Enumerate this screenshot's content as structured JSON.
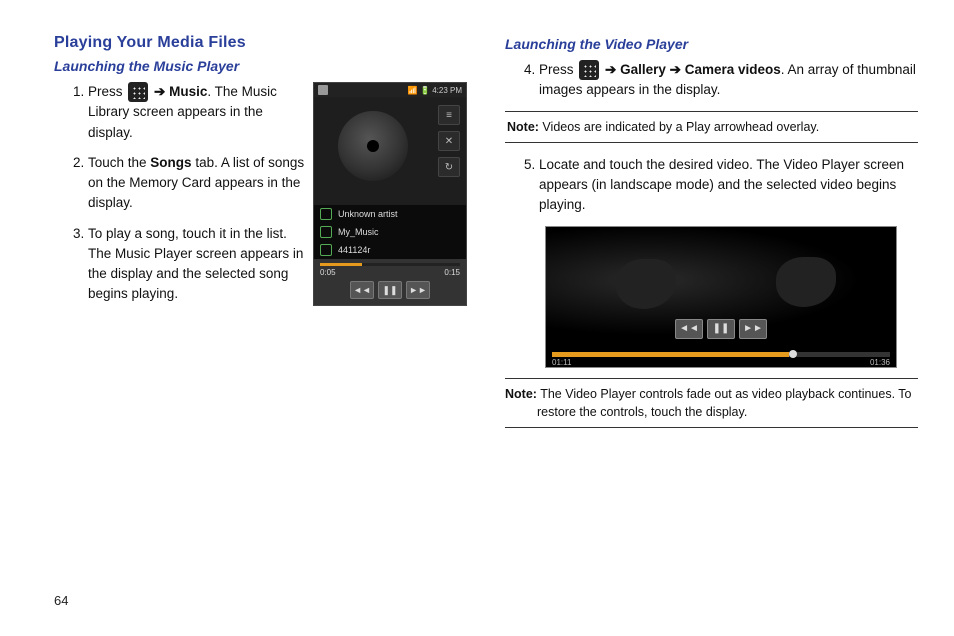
{
  "page_number": "64",
  "left": {
    "section_title": "Playing Your Media Files",
    "subhead": "Launching the Music Player",
    "steps": {
      "s1_a": "Press ",
      "s1_b": " ➔ ",
      "s1_c": "Music",
      "s1_d": ". The Music Library screen appears in the display.",
      "s2_a": "Touch the ",
      "s2_b": "Songs",
      "s2_c": " tab. A list of songs on the Memory Card appears in the display.",
      "s3": "To play a song, touch it in the list. The Music Player screen appears in the display and the selected song begins playing."
    },
    "phone": {
      "time": "4:23 PM",
      "artist": "Unknown artist",
      "album": "My_Music",
      "track": "441124r",
      "elapsed": "0:05",
      "total": "0:15",
      "side_btn_1": "≡",
      "side_btn_2": "✕",
      "side_btn_3": "↻",
      "ctrl_prev": "◄◄",
      "ctrl_pause": "❚❚",
      "ctrl_next": "►►"
    }
  },
  "right": {
    "subhead": "Launching the Video Player",
    "steps": {
      "s4_a": "Press ",
      "s4_b": " ➔ ",
      "s4_c": "Gallery",
      "s4_d": " ➔ ",
      "s4_e": "Camera videos",
      "s4_f": ". An array of thumbnail images appears in the display.",
      "s5": "Locate and touch the desired video. The Video Player screen appears (in landscape mode) and the selected video begins playing."
    },
    "note1_label": "Note:",
    "note1_text": " Videos are indicated by a Play arrowhead overlay.",
    "note2_label": "Note:",
    "note2_text": " The Video Player controls fade out as video playback continues. To restore the controls, touch the display.",
    "video": {
      "elapsed": "01:11",
      "total": "01:36",
      "ctrl_prev": "◄◄",
      "ctrl_pause": "❚❚",
      "ctrl_next": "►►"
    }
  }
}
